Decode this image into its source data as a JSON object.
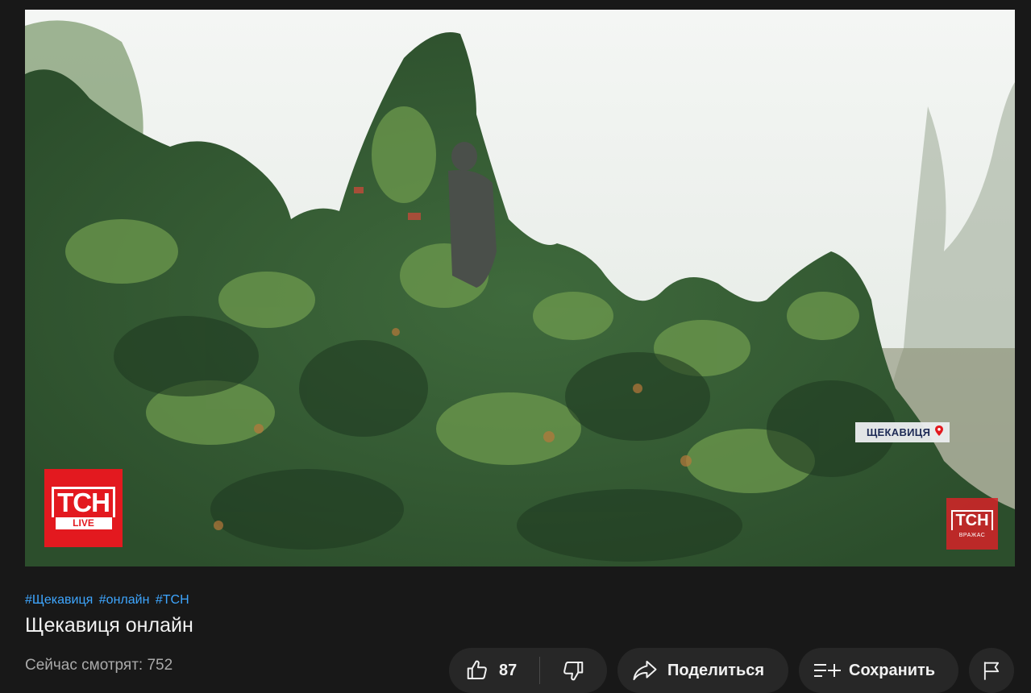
{
  "player": {
    "logo_main": "ТСН",
    "logo_live": "LIVE",
    "location": "ЩЕКАВИЦЯ",
    "corner_logo": "ТСН",
    "corner_sub": "ВРАЖАС"
  },
  "video": {
    "hashtags": [
      "#Щекавиця",
      "#онлайн",
      "#ТСН"
    ],
    "title": "Щекавиця онлайн",
    "viewers": "Сейчас смотрят: 752"
  },
  "actions": {
    "like_count": "87",
    "share_label": "Поделиться",
    "save_label": "Сохранить"
  },
  "colors": {
    "background": "#181818",
    "link": "#3ea6ff",
    "pill": "#272727",
    "brand_red": "#e3191f"
  }
}
